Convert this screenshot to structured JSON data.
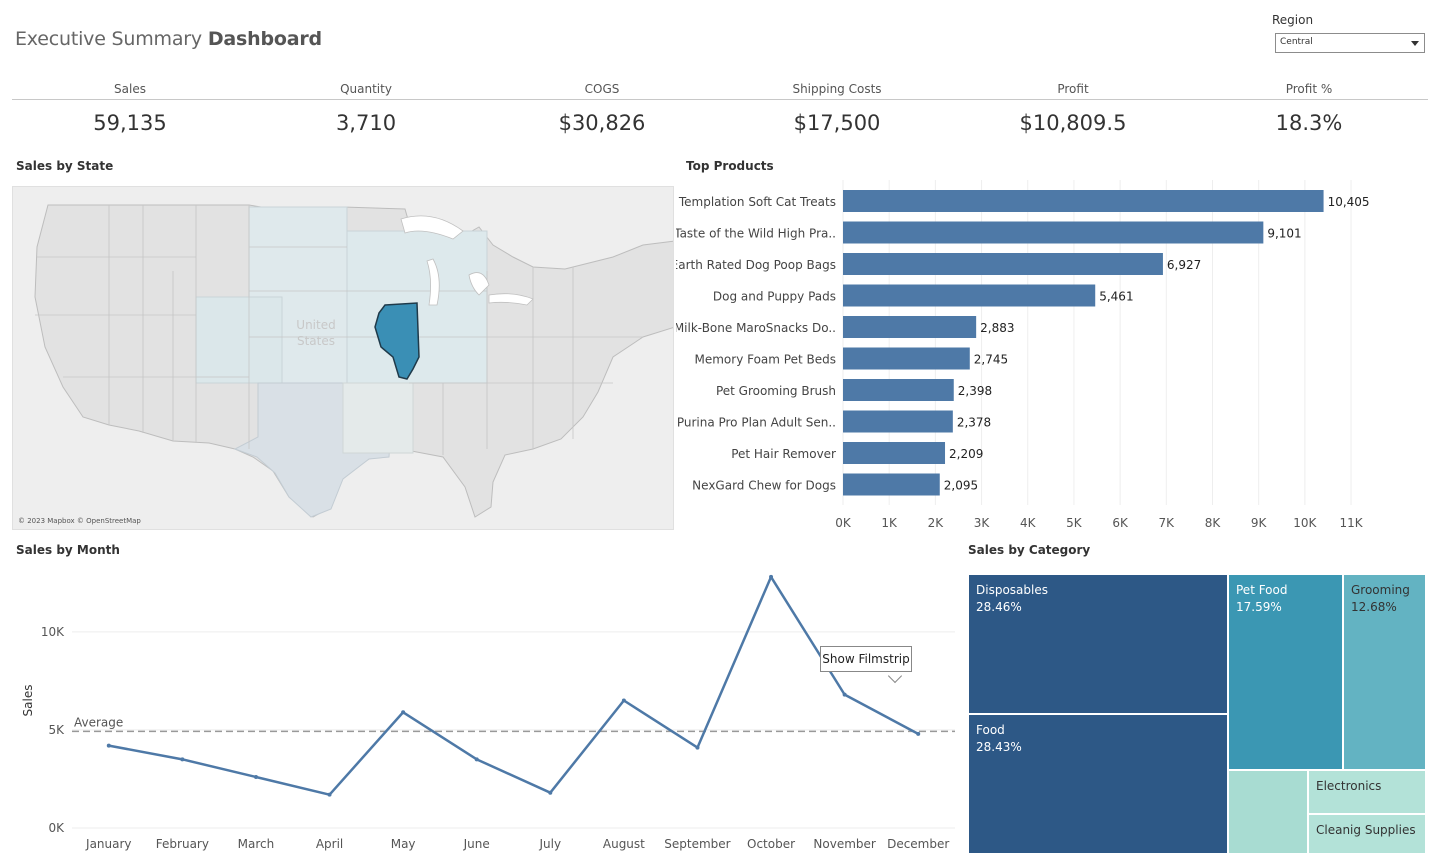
{
  "header": {
    "title_light": "Executive Summary ",
    "title_bold": "Dashboard",
    "region_label": "Region",
    "region_value": "Central"
  },
  "kpis": [
    {
      "label": "Sales",
      "value": "59,135"
    },
    {
      "label": "Quantity",
      "value": "3,710"
    },
    {
      "label": "COGS",
      "value": "$30,826"
    },
    {
      "label": "Shipping Costs",
      "value": "$17,500"
    },
    {
      "label": "Profit",
      "value": "$10,809.5"
    },
    {
      "label": "Profit %",
      "value": "18.3%"
    }
  ],
  "map": {
    "title": "Sales by State",
    "country_label_line1": "United",
    "country_label_line2": "States",
    "credit": "© 2023 Mapbox © OpenStreetMap",
    "highlight_color": "#3a8fb5"
  },
  "tooltip": {
    "label": "Show Filmstrip"
  },
  "colors": {
    "bar": "#4e79a7",
    "line": "#4e79a7",
    "average": "#999999",
    "treemap_dark": "#2d5886",
    "treemap_mid": "#3b97b3",
    "treemap_teal": "#63b3c2",
    "treemap_light": "#a8dcd2"
  },
  "chart_data": [
    {
      "id": "top-products",
      "type": "bar",
      "orientation": "horizontal",
      "title": "Top Products",
      "categories": [
        "Templation Soft Cat Treats",
        "Taste of the Wild High Pra..",
        "Earth Rated Dog Poop Bags",
        "Dog and Puppy Pads",
        "Milk-Bone MaroSnacks Do..",
        "Memory Foam Pet Beds",
        "Pet Grooming Brush",
        "Purina Pro Plan Adult Sen..",
        "Pet Hair Remover",
        "NexGard Chew for Dogs"
      ],
      "values": [
        10405,
        9101,
        6927,
        5461,
        2883,
        2745,
        2398,
        2378,
        2209,
        2095
      ],
      "value_labels": [
        "10,405",
        "9,101",
        "6,927",
        "5,461",
        "2,883",
        "2,745",
        "2,398",
        "2,378",
        "2,209",
        "2,095"
      ],
      "xlim": [
        0,
        11800
      ],
      "xticks": [
        0,
        1000,
        2000,
        3000,
        4000,
        5000,
        6000,
        7000,
        8000,
        9000,
        10000,
        11000
      ],
      "xtick_labels": [
        "0K",
        "1K",
        "2K",
        "3K",
        "4K",
        "5K",
        "6K",
        "7K",
        "8K",
        "9K",
        "10K",
        "11K"
      ],
      "grid": true
    },
    {
      "id": "sales-by-month",
      "type": "line",
      "title": "Sales by Month",
      "ylabel": "Sales",
      "x": [
        "January",
        "February",
        "March",
        "April",
        "May",
        "June",
        "July",
        "August",
        "September",
        "October",
        "November",
        "December"
      ],
      "y": [
        4200,
        3500,
        2600,
        1700,
        5900,
        3500,
        1800,
        6500,
        4100,
        12800,
        6800,
        4800
      ],
      "ylim": [
        0,
        13000
      ],
      "yticks": [
        0,
        5000,
        10000
      ],
      "ytick_labels": [
        "0K",
        "5K",
        "10K"
      ],
      "average": 4928,
      "average_label": "Average",
      "grid": true
    },
    {
      "id": "sales-by-category",
      "type": "treemap",
      "title": "Sales by Category",
      "categories": [
        "Disposables",
        "Food",
        "Pet Food",
        "Grooming",
        "Electronics",
        "Cleanig Supplies",
        ""
      ],
      "percent_labels": [
        "28.46%",
        "28.43%",
        "17.59%",
        "12.68%",
        "",
        "",
        ""
      ]
    }
  ]
}
